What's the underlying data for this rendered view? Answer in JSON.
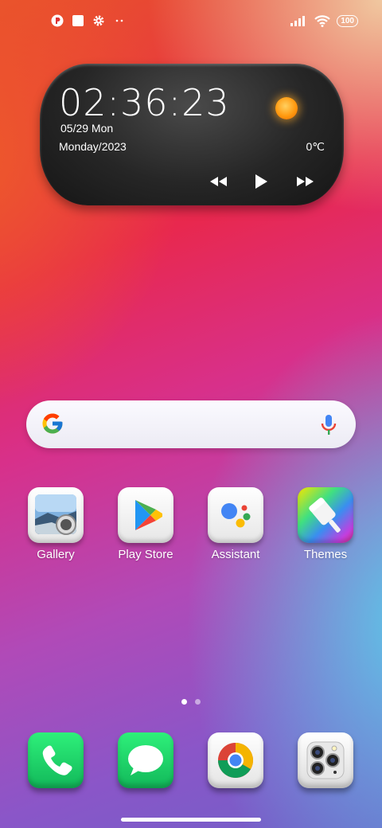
{
  "status_bar": {
    "left_icons": [
      "app-notification-icon",
      "square-notification-icon",
      "settings-gear-icon",
      "more-dots-icon"
    ],
    "right_icons": [
      "signal-icon",
      "wifi-icon",
      "battery-icon"
    ],
    "battery": "100"
  },
  "clock_widget": {
    "time": "02:36:23",
    "date": "05/29 Mon",
    "day_year": "Monday/2023",
    "temperature": "0℃",
    "weather_icon": "sun-icon",
    "controls": [
      "rewind-icon",
      "play-icon",
      "fast-forward-icon"
    ]
  },
  "search": {
    "logo": "google-logo",
    "mic_icon": "microphone-icon"
  },
  "apps": [
    {
      "label": "Gallery",
      "icon": "gallery-icon"
    },
    {
      "label": "Play Store",
      "icon": "play-store-icon"
    },
    {
      "label": "Assistant",
      "icon": "assistant-icon"
    },
    {
      "label": "Themes",
      "icon": "themes-icon"
    }
  ],
  "page_indicator": {
    "pages": 2,
    "active": 1
  },
  "dock": [
    {
      "icon": "phone-icon"
    },
    {
      "icon": "messages-icon"
    },
    {
      "icon": "chrome-icon"
    },
    {
      "icon": "camera-icon"
    }
  ],
  "colors": {
    "accent_green": "#12b85a",
    "widget_dark": "#262626",
    "sun": "#ff9a10"
  }
}
